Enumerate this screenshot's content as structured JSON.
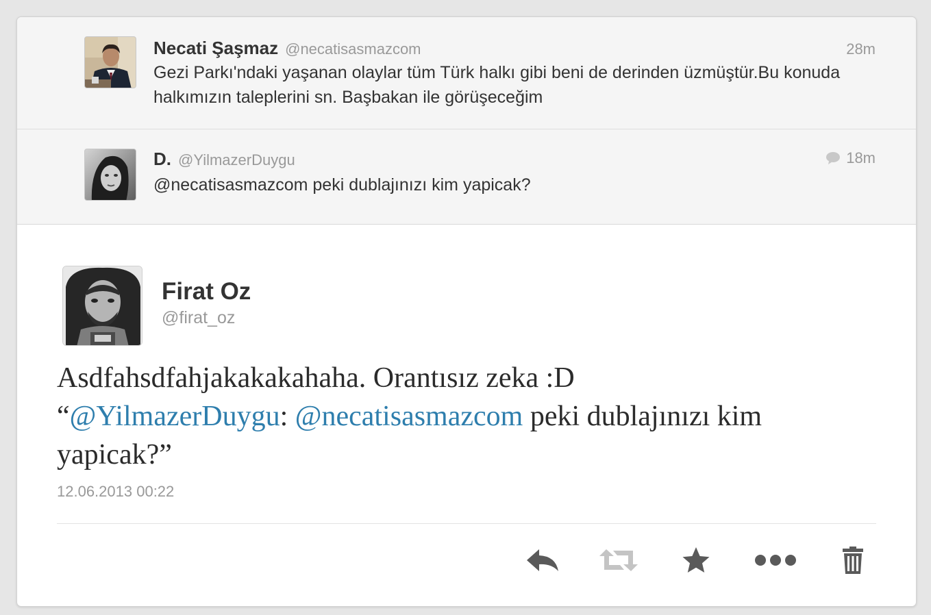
{
  "context_tweets": [
    {
      "name": "Necati Şaşmaz",
      "handle": "@necatisasmazcom",
      "time": "28m",
      "text": "Gezi Parkı'ndaki yaşanan olaylar tüm Türk halkı gibi beni de derinden üzmüştür.Bu konuda halkımızın taleplerini sn. Başbakan ile görüşeceğim"
    },
    {
      "name": "D.",
      "handle": "@YilmazerDuygu",
      "time": "18m",
      "text": "@necatisasmazcom peki dublajınızı kim yapicak?"
    }
  ],
  "main_tweet": {
    "name": "Firat Oz",
    "handle": "@firat_oz",
    "text_line1": "Asdfahsdfahjakakakahaha.  Orantısız zeka :D",
    "quote_open": "“",
    "mention1": "@YilmazerDuygu",
    "sep": ": ",
    "mention2": "@necatisasmazcom",
    "rest": " peki dublajınızı kim yapicak?”",
    "timestamp": "12.06.2013 00:22"
  },
  "actions": [
    "reply-icon",
    "retweet-icon",
    "favorite-icon",
    "more-icon",
    "delete-icon"
  ],
  "colors": {
    "mention": "#2e7ead",
    "icon_active": "#555555",
    "icon_disabled": "#c4c4c4"
  }
}
